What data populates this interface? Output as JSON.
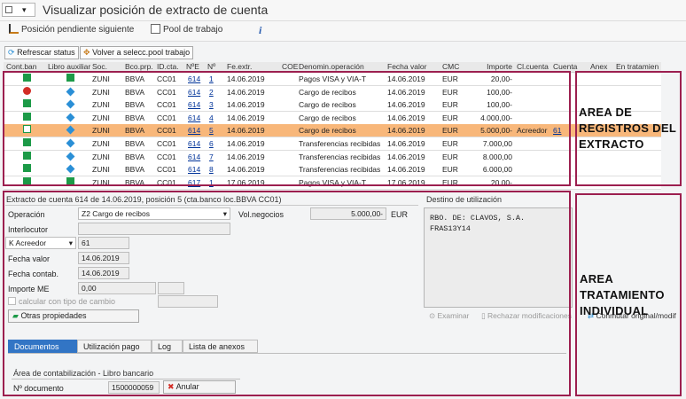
{
  "window": {
    "title": "Visualizar posición de extracto de cuenta"
  },
  "toolbar": {
    "next_position": "Posición pendiente siguiente",
    "work_pool": "Pool de trabajo"
  },
  "buttons": {
    "refresh_status": "Refrescar status",
    "back_to_pool": "Volver a selecc.pool trabajo"
  },
  "grid": {
    "headers": [
      "Cont.ban",
      "Libro auxiliar",
      "Soc.",
      "Bco.prp.",
      "ID.cta.",
      "NºE",
      "Nº",
      "Fe.extr.",
      "COE",
      "Denomin.operación",
      "Fecha valor",
      "CMC",
      "Importe",
      "Cl.cuenta",
      "Cuenta",
      "Anex",
      "En tratamien"
    ],
    "rows": [
      {
        "cont_ban": "green-square",
        "libro": "green-square",
        "soc": "ZUNI",
        "bco": "BBVA",
        "idcta": "CC01",
        "ne": "614",
        "n": "1",
        "fecha": "14.06.2019",
        "coe": "",
        "denom": "Pagos VISA y VIA-T",
        "fecha_valor": "14.06.2019",
        "cmc": "EUR",
        "importe": "20,00-",
        "cl_cuenta": "",
        "cuenta": ""
      },
      {
        "cont_ban": "red-circle",
        "libro": "blue-diamond",
        "soc": "ZUNI",
        "bco": "BBVA",
        "idcta": "CC01",
        "ne": "614",
        "n": "2",
        "fecha": "14.06.2019",
        "coe": "",
        "denom": "Cargo de recibos",
        "fecha_valor": "14.06.2019",
        "cmc": "EUR",
        "importe": "100,00-",
        "cl_cuenta": "",
        "cuenta": ""
      },
      {
        "cont_ban": "green-square",
        "libro": "blue-diamond",
        "soc": "ZUNI",
        "bco": "BBVA",
        "idcta": "CC01",
        "ne": "614",
        "n": "3",
        "fecha": "14.06.2019",
        "coe": "",
        "denom": "Cargo de recibos",
        "fecha_valor": "14.06.2019",
        "cmc": "EUR",
        "importe": "100,00-",
        "cl_cuenta": "",
        "cuenta": ""
      },
      {
        "cont_ban": "green-square",
        "libro": "blue-diamond",
        "soc": "ZUNI",
        "bco": "BBVA",
        "idcta": "CC01",
        "ne": "614",
        "n": "4",
        "fecha": "14.06.2019",
        "coe": "",
        "denom": "Cargo de recibos",
        "fecha_valor": "14.06.2019",
        "cmc": "EUR",
        "importe": "4.000,00-",
        "cl_cuenta": "",
        "cuenta": ""
      },
      {
        "cont_ban": "green-outline",
        "libro": "blue-diamond",
        "soc": "ZUNI",
        "bco": "BBVA",
        "idcta": "CC01",
        "ne": "614",
        "n": "5",
        "fecha": "14.06.2019",
        "coe": "",
        "denom": "Cargo de recibos",
        "fecha_valor": "14.06.2019",
        "cmc": "EUR",
        "importe": "5.000,00-",
        "cl_cuenta": "Acreedor",
        "cuenta": "61"
      },
      {
        "cont_ban": "green-square",
        "libro": "blue-diamond",
        "soc": "ZUNI",
        "bco": "BBVA",
        "idcta": "CC01",
        "ne": "614",
        "n": "6",
        "fecha": "14.06.2019",
        "coe": "",
        "denom": "Transferencias recibidas",
        "fecha_valor": "14.06.2019",
        "cmc": "EUR",
        "importe": "7.000,00",
        "cl_cuenta": "",
        "cuenta": ""
      },
      {
        "cont_ban": "green-square",
        "libro": "blue-diamond",
        "soc": "ZUNI",
        "bco": "BBVA",
        "idcta": "CC01",
        "ne": "614",
        "n": "7",
        "fecha": "14.06.2019",
        "coe": "",
        "denom": "Transferencias recibidas",
        "fecha_valor": "14.06.2019",
        "cmc": "EUR",
        "importe": "8.000,00",
        "cl_cuenta": "",
        "cuenta": ""
      },
      {
        "cont_ban": "green-square",
        "libro": "blue-diamond",
        "soc": "ZUNI",
        "bco": "BBVA",
        "idcta": "CC01",
        "ne": "614",
        "n": "8",
        "fecha": "14.06.2019",
        "coe": "",
        "denom": "Transferencias recibidas",
        "fecha_valor": "14.06.2019",
        "cmc": "EUR",
        "importe": "6.000,00",
        "cl_cuenta": "",
        "cuenta": ""
      },
      {
        "cont_ban": "green-square",
        "libro": "green-square",
        "soc": "ZUNI",
        "bco": "BBVA",
        "idcta": "CC01",
        "ne": "617",
        "n": "1",
        "fecha": "17.06.2019",
        "coe": "",
        "denom": "Pagos VISA y VIA-T",
        "fecha_valor": "17.06.2019",
        "cmc": "EUR",
        "importe": "20,00-",
        "cl_cuenta": "",
        "cuenta": ""
      }
    ]
  },
  "detail": {
    "title": "Extracto de cuenta 614 de 14.06.2019, posición 5 (cta.banco loc.BBVA CC01)",
    "operacion_label": "Operación",
    "operacion_value": "Z2 Cargo de recibos",
    "vol_label": "Vol.negocios",
    "vol_value": "5.000,00-",
    "vol_currency": "EUR",
    "interlocutor_label": "Interlocutor",
    "kacreedor_label": "K Acreedor",
    "kacreedor_value": "61",
    "fecha_valor_label": "Fecha valor",
    "fecha_valor_value": "14.06.2019",
    "fecha_contab_label": "Fecha contab.",
    "fecha_contab_value": "14.06.2019",
    "importe_me_label": "Importe ME",
    "importe_me_value": "0,00",
    "calcular_label": "calcular con tipo de cambio",
    "otras_label": "Otras propiedades"
  },
  "destino": {
    "title": "Destino de utilización",
    "line1": "RBO. DE: CLAVOS, S.A.",
    "line2": "FRAS13Y14",
    "examinar": "Examinar",
    "rechazar": "Rechazar modificaciones",
    "conmutar": "Conmutar original/modif"
  },
  "tabs": [
    "Documentos",
    "Utilización pago",
    "Log",
    "Lista de anexos"
  ],
  "documents": {
    "area_title": "Área de contabilización - Libro bancario",
    "doc_label": "Nº documento",
    "doc_value": "1500000059",
    "anular": "Anular"
  },
  "annotations": {
    "records_1": "AREA DE",
    "records_2": "REGISTROS DEL",
    "records_3": "EXTRACTO",
    "treat_1": "AREA",
    "treat_2": "TRATAMIENTO",
    "treat_3": "INDIVIDUAL"
  },
  "colors": {
    "selected_row": "#f8b77a",
    "annotation_box": "#9c1f4f",
    "active_tab": "#3275c5"
  }
}
